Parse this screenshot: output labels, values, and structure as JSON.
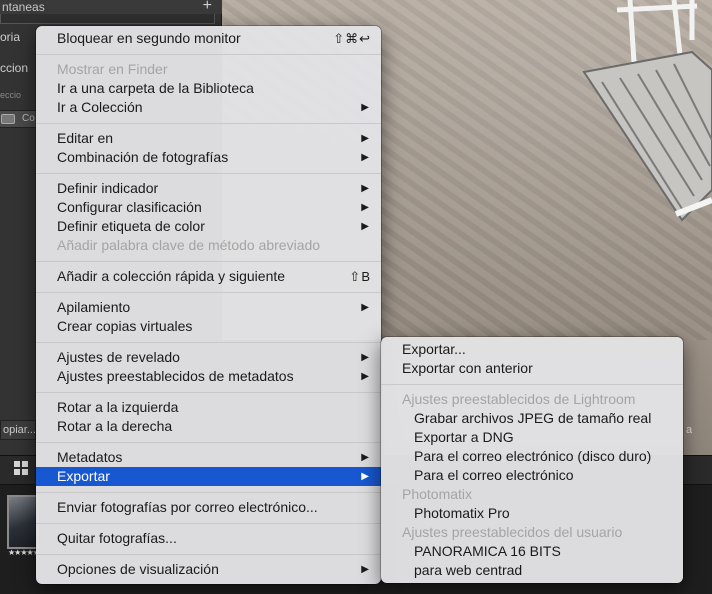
{
  "left_panel": {
    "header": "ntaneas",
    "plus": "+",
    "row1": "oria",
    "row2": "ccion",
    "row3": "eccio",
    "strip_label": "Co",
    "copy_button": "opiar..."
  },
  "photo_tail_label": "a",
  "filmstrip": {
    "stars": "★★★★★"
  },
  "main_menu": [
    {
      "label": "Bloquear en segundo monitor",
      "shortcut": "⇧⌘↩"
    },
    {
      "label": "Mostrar en Finder",
      "disabled": true
    },
    {
      "label": "Ir a una carpeta de la Biblioteca"
    },
    {
      "label": "Ir a Colección",
      "submenu": true
    },
    {
      "label": "Editar en",
      "submenu": true
    },
    {
      "label": "Combinación de fotografías",
      "submenu": true
    },
    {
      "label": "Definir indicador",
      "submenu": true
    },
    {
      "label": "Configurar clasificación",
      "submenu": true
    },
    {
      "label": "Definir etiqueta de color",
      "submenu": true
    },
    {
      "label": "Añadir palabra clave de método abreviado",
      "disabled": true
    },
    {
      "label": "Añadir a colección rápida y siguiente",
      "shortcut": "⇧B"
    },
    {
      "label": "Apilamiento",
      "submenu": true
    },
    {
      "label": "Crear copias virtuales"
    },
    {
      "label": "Ajustes de revelado",
      "submenu": true
    },
    {
      "label": "Ajustes preestablecidos de metadatos",
      "submenu": true
    },
    {
      "label": "Rotar a la izquierda"
    },
    {
      "label": "Rotar a la derecha"
    },
    {
      "label": "Metadatos",
      "submenu": true
    },
    {
      "label": "Exportar",
      "submenu": true,
      "selected": true
    },
    {
      "label": "Enviar fotografías por correo electrónico..."
    },
    {
      "label": "Quitar fotografías..."
    },
    {
      "label": "Opciones de visualización",
      "submenu": true
    }
  ],
  "export_submenu": [
    {
      "label": "Exportar..."
    },
    {
      "label": "Exportar con anterior"
    },
    {
      "label": "Ajustes preestablecidos de Lightroom",
      "header": true
    },
    {
      "label": "Grabar archivos JPEG de tamaño real",
      "child": true
    },
    {
      "label": "Exportar a DNG",
      "child": true
    },
    {
      "label": "Para el correo electrónico (disco duro)",
      "child": true
    },
    {
      "label": "Para el correo electrónico",
      "child": true
    },
    {
      "label": "Photomatix",
      "header": true
    },
    {
      "label": "Photomatix Pro",
      "child": true
    },
    {
      "label": "Ajustes preestablecidos del usuario",
      "header": true
    },
    {
      "label": "PANORAMICA 16 BITS",
      "child": true
    },
    {
      "label": "para web centrad",
      "child": true
    }
  ],
  "icons": {
    "submenu_arrow": "▶",
    "grid_view": "grid-icon"
  },
  "colors": {
    "selection": "#1757d0",
    "menu_bg": "#e2e2e4",
    "disabled_text": "#a4a4a4"
  }
}
